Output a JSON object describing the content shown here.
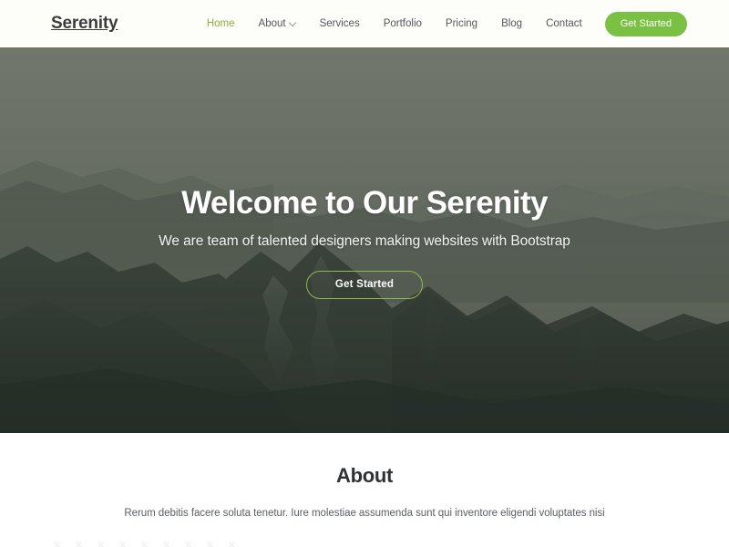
{
  "navbar": {
    "brand": "Serenity",
    "links": [
      {
        "label": "Home",
        "active": true,
        "dropdown": false
      },
      {
        "label": "About",
        "active": false,
        "dropdown": true
      },
      {
        "label": "Services",
        "active": false,
        "dropdown": false
      },
      {
        "label": "Portfolio",
        "active": false,
        "dropdown": false
      },
      {
        "label": "Pricing",
        "active": false,
        "dropdown": false
      },
      {
        "label": "Blog",
        "active": false,
        "dropdown": false
      },
      {
        "label": "Contact",
        "active": false,
        "dropdown": false
      }
    ],
    "cta_label": "Get Started",
    "cta_color": "#7ac043",
    "active_color": "#8aae3a",
    "background": "#fdfdfa"
  },
  "hero": {
    "title": "Welcome to Our Serenity",
    "subtitle": "We are team of talented designers making websites with Bootstrap",
    "cta_label": "Get Started",
    "cta_border_color": "#93b84a",
    "background_image": "mountain-landscape-photo"
  },
  "about": {
    "title": "About",
    "text": "Rerum debitis facere soluta tenetur. Iure molestiae assumenda sunt qui inventore eligendi voluptates nisi",
    "broken_images": [
      "broken-image-icon",
      "broken-image-icon",
      "broken-image-icon",
      "broken-image-icon",
      "broken-image-icon",
      "broken-image-icon",
      "broken-image-icon",
      "broken-image-icon",
      "broken-image-icon"
    ]
  }
}
